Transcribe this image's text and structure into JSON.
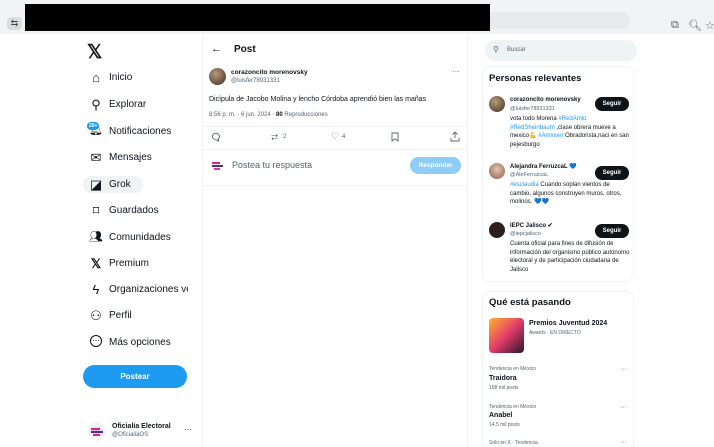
{
  "browser": {
    "site_icon": "⇆",
    "icons": [
      "cast-icon",
      "zoom-icon",
      "star-icon"
    ],
    "cast_glyph": "⧉",
    "zoom_glyph": "🔍︎",
    "star_glyph": "☆"
  },
  "nav": {
    "logo": "𝕏",
    "items": [
      {
        "icon": "⌂",
        "label": "Inicio"
      },
      {
        "icon": "⚲",
        "label": "Explorar"
      },
      {
        "icon": "🔔︎",
        "label": "Notificaciones",
        "badge": "20+"
      },
      {
        "icon": "✉",
        "label": "Mensajes"
      },
      {
        "icon": "◪",
        "label": "Grok"
      },
      {
        "icon": "⌑",
        "label": "Guardados"
      },
      {
        "icon": "👥︎",
        "label": "Comunidades"
      },
      {
        "icon": "𝕏",
        "label": "Premium"
      },
      {
        "icon": "ϟ",
        "label": "Organizaciones ver"
      },
      {
        "icon": "⚇",
        "label": "Perfil"
      },
      {
        "icon": "⋯",
        "label": "Más opciones"
      }
    ],
    "post_button": "Postear",
    "account": {
      "name": "Oficialía Electoral",
      "handle": "@OficialiaOS",
      "more": "···"
    }
  },
  "post_view": {
    "back": "←",
    "header": "Post",
    "author_name": "corazoncito morenovsky",
    "author_handle": "@luisfer78931331",
    "more": "···",
    "text": "Dicípula de Jacobo Molina y lencho  Córdoba aprendió bien las mañas",
    "time": "8:56 p. m. · 6 jun. 2024 · ",
    "views_count": "80",
    "views_label": " Reproducciones",
    "actions": {
      "reply": "",
      "retweet": "2",
      "like": "4",
      "bookmark": "",
      "share": ""
    },
    "reply_placeholder": "Postea tu respuesta",
    "reply_button": "Responder"
  },
  "right": {
    "search_placeholder": "Buscar",
    "relevant_title": "Personas relevantes",
    "people": [
      {
        "name": "corazoncito morenovsky",
        "handle": "@luisfer78931331",
        "follow": "Seguir",
        "bio1": "vota todo Morena ",
        "bio_link1": "#RedAmlo",
        "bio_link2": "#RedSheinbaum",
        "bio2": " ,clase obrera mueve a mexico💪 ",
        "bio_link3": "#Amlover",
        "bio3": " Obradorista,naci en san pejesburgo"
      },
      {
        "name": "Alejandra FerruzcaL 💙",
        "handle": "@AleFerruzcaL",
        "follow": "Seguir",
        "bio_link1": "#esclaudia",
        "bio2": " Cuando soplan vientos de cambio, algunos construyen muros, otros, molinos. 💙💙"
      },
      {
        "name": "IEPC Jalisco ✔",
        "handle": "@iepcjalisco",
        "follow": "Seguir",
        "bio2": "Cuenta oficial para fines de difusión de información del organismo público autónomo electoral y de participación ciudadana de Jalisco"
      }
    ],
    "trending_title": "Qué está pasando",
    "event": {
      "title": "Premios Juventud 2024",
      "subtitle": "Awards · EN DIRECTO"
    },
    "trends": [
      {
        "context": "Tendencia en México",
        "name": "Traidora",
        "posts": "158 mil posts"
      },
      {
        "context": "Tendencia en México",
        "name": "Anabel",
        "posts": "14,5 mil posts"
      },
      {
        "context": "Solo en X · Tendencia",
        "name": "",
        "posts": ""
      }
    ],
    "trend_more": "···"
  },
  "colors": {
    "accent": "#1d9bf0",
    "text": "#0f1419",
    "muted": "#536471"
  }
}
